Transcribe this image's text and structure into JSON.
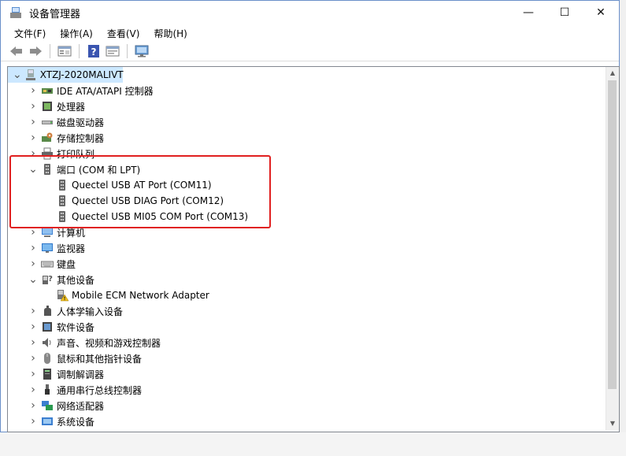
{
  "window": {
    "title": "设备管理器",
    "controls": {
      "minimize": "—",
      "maximize": "☐",
      "close": "✕"
    }
  },
  "menu": [
    "文件(F)",
    "操作(A)",
    "查看(V)",
    "帮助(H)"
  ],
  "toolbar": [
    "back-icon",
    "forward-icon",
    "properties-icon",
    "help-icon",
    "update-driver-icon",
    "scan-monitor-icon"
  ],
  "tree": {
    "root": "XTZJ-2020MALIVT",
    "items": [
      {
        "label": "IDE ATA/ATAPI 控制器",
        "icon": "ide-controller-icon",
        "expanded": false
      },
      {
        "label": "处理器",
        "icon": "processor-icon",
        "expanded": false
      },
      {
        "label": "磁盘驱动器",
        "icon": "disk-drive-icon",
        "expanded": false
      },
      {
        "label": "存储控制器",
        "icon": "storage-controller-icon",
        "expanded": false
      },
      {
        "label": "打印队列",
        "icon": "print-queue-icon",
        "expanded": false
      },
      {
        "label": "端口 (COM 和 LPT)",
        "icon": "port-icon",
        "expanded": true,
        "children": [
          {
            "label": "Quectel USB AT Port (COM11)",
            "icon": "port-icon"
          },
          {
            "label": "Quectel USB DIAG Port (COM12)",
            "icon": "port-icon"
          },
          {
            "label": "Quectel USB MI05 COM Port (COM13)",
            "icon": "port-icon"
          }
        ]
      },
      {
        "label": "计算机",
        "icon": "computer-icon",
        "expanded": false
      },
      {
        "label": "监视器",
        "icon": "monitor-icon",
        "expanded": false
      },
      {
        "label": "键盘",
        "icon": "keyboard-icon",
        "expanded": false
      },
      {
        "label": "其他设备",
        "icon": "other-devices-icon",
        "expanded": true,
        "children": [
          {
            "label": "Mobile ECM Network Adapter",
            "icon": "warning-device-icon"
          }
        ]
      },
      {
        "label": "人体学输入设备",
        "icon": "hid-icon",
        "expanded": false
      },
      {
        "label": "软件设备",
        "icon": "software-device-icon",
        "expanded": false
      },
      {
        "label": "声音、视频和游戏控制器",
        "icon": "sound-icon",
        "expanded": false
      },
      {
        "label": "鼠标和其他指针设备",
        "icon": "mouse-icon",
        "expanded": false
      },
      {
        "label": "调制解调器",
        "icon": "modem-icon",
        "expanded": false
      },
      {
        "label": "通用串行总线控制器",
        "icon": "usb-icon",
        "expanded": false
      },
      {
        "label": "网络适配器",
        "icon": "network-adapter-icon",
        "expanded": false
      },
      {
        "label": "系统设备",
        "icon": "system-device-icon",
        "expanded": false
      }
    ]
  },
  "colors": {
    "selection": "#cce8ff",
    "highlight_box": "#e02020",
    "accent": "#6a8fc9"
  }
}
